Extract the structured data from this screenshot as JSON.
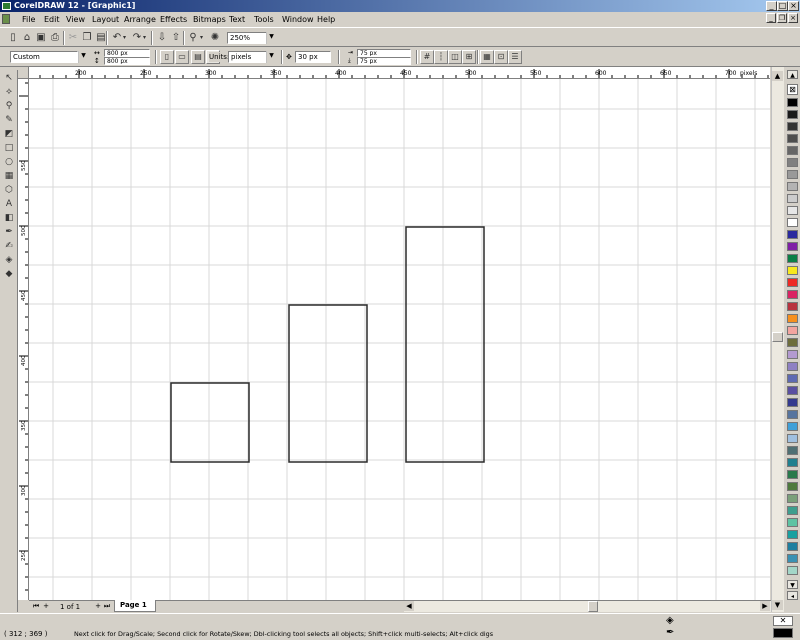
{
  "window": {
    "title": "CorelDRAW 12 - [Graphic1]"
  },
  "menu": [
    "File",
    "Edit",
    "View",
    "Layout",
    "Arrange",
    "Effects",
    "Bitmaps",
    "Text",
    "Tools",
    "Window",
    "Help"
  ],
  "toolbar": {
    "zoom": "250%"
  },
  "property_bar": {
    "preset": "Custom",
    "width": "800 px",
    "height": "800 px",
    "units_label": "Units:",
    "units": "pixels",
    "nudge": "30 px",
    "dup_x": "75 px",
    "dup_y": "75 px"
  },
  "ruler": {
    "h_ticks": [
      "200",
      "250",
      "300",
      "350",
      "400",
      "450",
      "500",
      "550",
      "600",
      "650",
      "700"
    ],
    "h_unit": "pixels",
    "v_ticks": [
      "550",
      "500",
      "450",
      "400",
      "350",
      "300",
      "250"
    ],
    "v_unit": "pixels"
  },
  "page_nav": {
    "counter": "1 of 1",
    "tab": "Page 1"
  },
  "status": {
    "coords": "( 312 ; 369 )",
    "hint": "Next click for Drag/Scale; Second click for Rotate/Skew; Dbl-clicking tool selects all objects; Shift+click multi-selects; Alt+click digs"
  },
  "palette": [
    "#000000",
    "#1a1a1a",
    "#333333",
    "#4d4d4d",
    "#666666",
    "#808080",
    "#999999",
    "#b3b3b3",
    "#cccccc",
    "#e6e6e6",
    "#ffffff",
    "#2a2a9e",
    "#7f1fa6",
    "#0a7f45",
    "#f7e81e",
    "#ee2a24",
    "#d92464",
    "#b8323f",
    "#f6901e",
    "#f2a49f",
    "#6d6d3b",
    "#b39ad0",
    "#8e80c3",
    "#5e6ab2",
    "#5a4fa1",
    "#343a8e",
    "#57749e",
    "#40a0d8",
    "#9fbfdf",
    "#4e6f73",
    "#20808f",
    "#297a4c",
    "#4e7a3d",
    "#7aa07a",
    "#3d9e8e",
    "#5dc3a3",
    "#19a0a0",
    "#1e7fa0",
    "#3a91b3",
    "#a3d6c8"
  ],
  "icons": {
    "toolbox": [
      "pick-tool-icon",
      "shape-tool-icon",
      "zoom-tool-icon",
      "freehand-tool-icon",
      "smart-fill-icon",
      "rectangle-tool-icon",
      "ellipse-tool-icon",
      "polygon-tool-icon",
      "text-tool-icon",
      "blend-tool-icon",
      "eyedropper-tool-icon",
      "outline-tool-icon",
      "fill-tool-icon",
      "interactive-fill-icon"
    ]
  }
}
